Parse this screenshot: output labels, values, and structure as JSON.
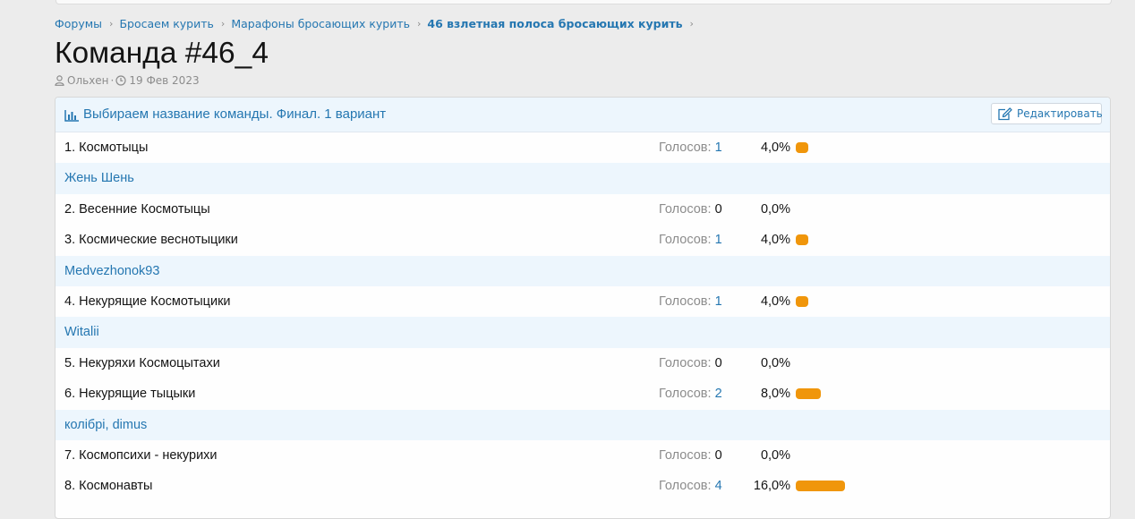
{
  "breadcrumb": [
    "Форумы",
    "Бросаем курить",
    "Марафоны бросающих курить",
    "46 взлетная полоса бросающих курить"
  ],
  "page_title": "Команда #46_4",
  "meta": {
    "author": "Ольхен",
    "separator": "·",
    "date": "19 Фев 2023"
  },
  "poll": {
    "title": "Выбираем название команды. Финал. 1 вариант",
    "edit_label": "Редактировать",
    "votes_label": "Голосов:",
    "rows": [
      {
        "type": "option",
        "label": "1. Космотыцы",
        "votes": "1",
        "percent": "4,0%",
        "share": 4
      },
      {
        "type": "voters",
        "label": "Жень Шень"
      },
      {
        "type": "option",
        "label": "2. Весенние Космотыцы",
        "votes": "0",
        "percent": "0,0%",
        "share": 0
      },
      {
        "type": "option",
        "label": "3. Космические веснотыцики",
        "votes": "1",
        "percent": "4,0%",
        "share": 4
      },
      {
        "type": "voters",
        "label": "Medvezhonok93"
      },
      {
        "type": "option",
        "label": "4. Некурящие Космотыцики",
        "votes": "1",
        "percent": "4,0%",
        "share": 4
      },
      {
        "type": "voters",
        "label": "Witalii"
      },
      {
        "type": "option",
        "label": "5. Некуряхи Космоцытахи",
        "votes": "0",
        "percent": "0,0%",
        "share": 0
      },
      {
        "type": "option",
        "label": "6. Некурящие тыцыки",
        "votes": "2",
        "percent": "8,0%",
        "share": 8
      },
      {
        "type": "voters",
        "label": "колібрі, dimus"
      },
      {
        "type": "option",
        "label": "7. Космопсихи - некурихи",
        "votes": "0",
        "percent": "0,0%",
        "share": 0
      },
      {
        "type": "option",
        "label": "8. Космонавты",
        "votes": "4",
        "percent": "16,0%",
        "share": 16
      }
    ]
  },
  "colors": {
    "link": "#2577b1",
    "bar": "#f0960b",
    "header_bg": "#edf6fd",
    "page_bg": "#ececec"
  },
  "icons": [
    "chevron-right-icon",
    "user-icon",
    "clock-icon",
    "bar-chart-icon",
    "edit-icon"
  ]
}
